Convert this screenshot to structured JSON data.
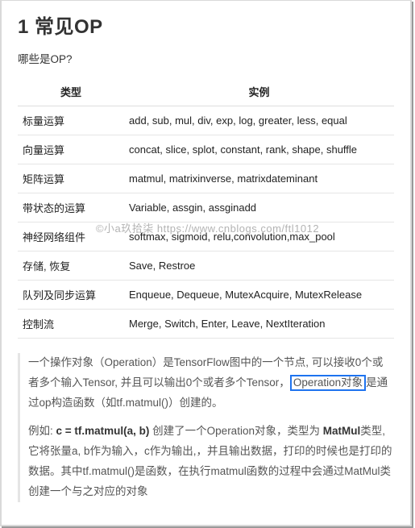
{
  "heading": "1 常见OP",
  "intro": "哪些是OP?",
  "table": {
    "headers": [
      "类型",
      "实例"
    ],
    "rows": [
      {
        "type": "标量运算",
        "inst": "add, sub, mul, div, exp, log, greater, less, equal"
      },
      {
        "type": "向量运算",
        "inst": "concat, slice, splot, constant, rank, shape, shuffle"
      },
      {
        "type": "矩阵运算",
        "inst": "matmul, matrixinverse, matrixdateminant"
      },
      {
        "type": "带状态的运算",
        "inst": "Variable, assgin, assginadd"
      },
      {
        "type": "神经网络组件",
        "inst": "softmax, sigmoid, relu,convolution,max_pool"
      },
      {
        "type": "存储, 恢复",
        "inst": "Save, Restroe"
      },
      {
        "type": "队列及同步运算",
        "inst": "Enqueue, Dequeue, MutexAcquire, MutexRelease"
      },
      {
        "type": "控制流",
        "inst": "Merge, Switch, Enter, Leave, NextIteration"
      }
    ]
  },
  "note": {
    "p1a": "一个操作对象（Operation）是TensorFlow图中的一个节点, 可以接收0个或者多个输入Tensor, 并且可以输出0个或者多个Tensor，",
    "p1h": "Operation对象",
    "p1b": "是通过op构造函数（如tf.matmul()）创建的。",
    "p2a": "例如: ",
    "p2b": "c = tf.matmul(a, b) ",
    "p2c": "创建了一个Operation对象，类型为 ",
    "p2d": "MatMul",
    "p2e": "类型, 它将张量a, b作为输入，c作为输出,，并且输出数据，打印的时候也是打印的数据。其中tf.matmul()是函数，在执行matmul函数的过程中会通过MatMul类创建一个与之对应的对象"
  },
  "watermark": "©小a玖拾柒  https://www.cnblogs.com/ftl1012"
}
